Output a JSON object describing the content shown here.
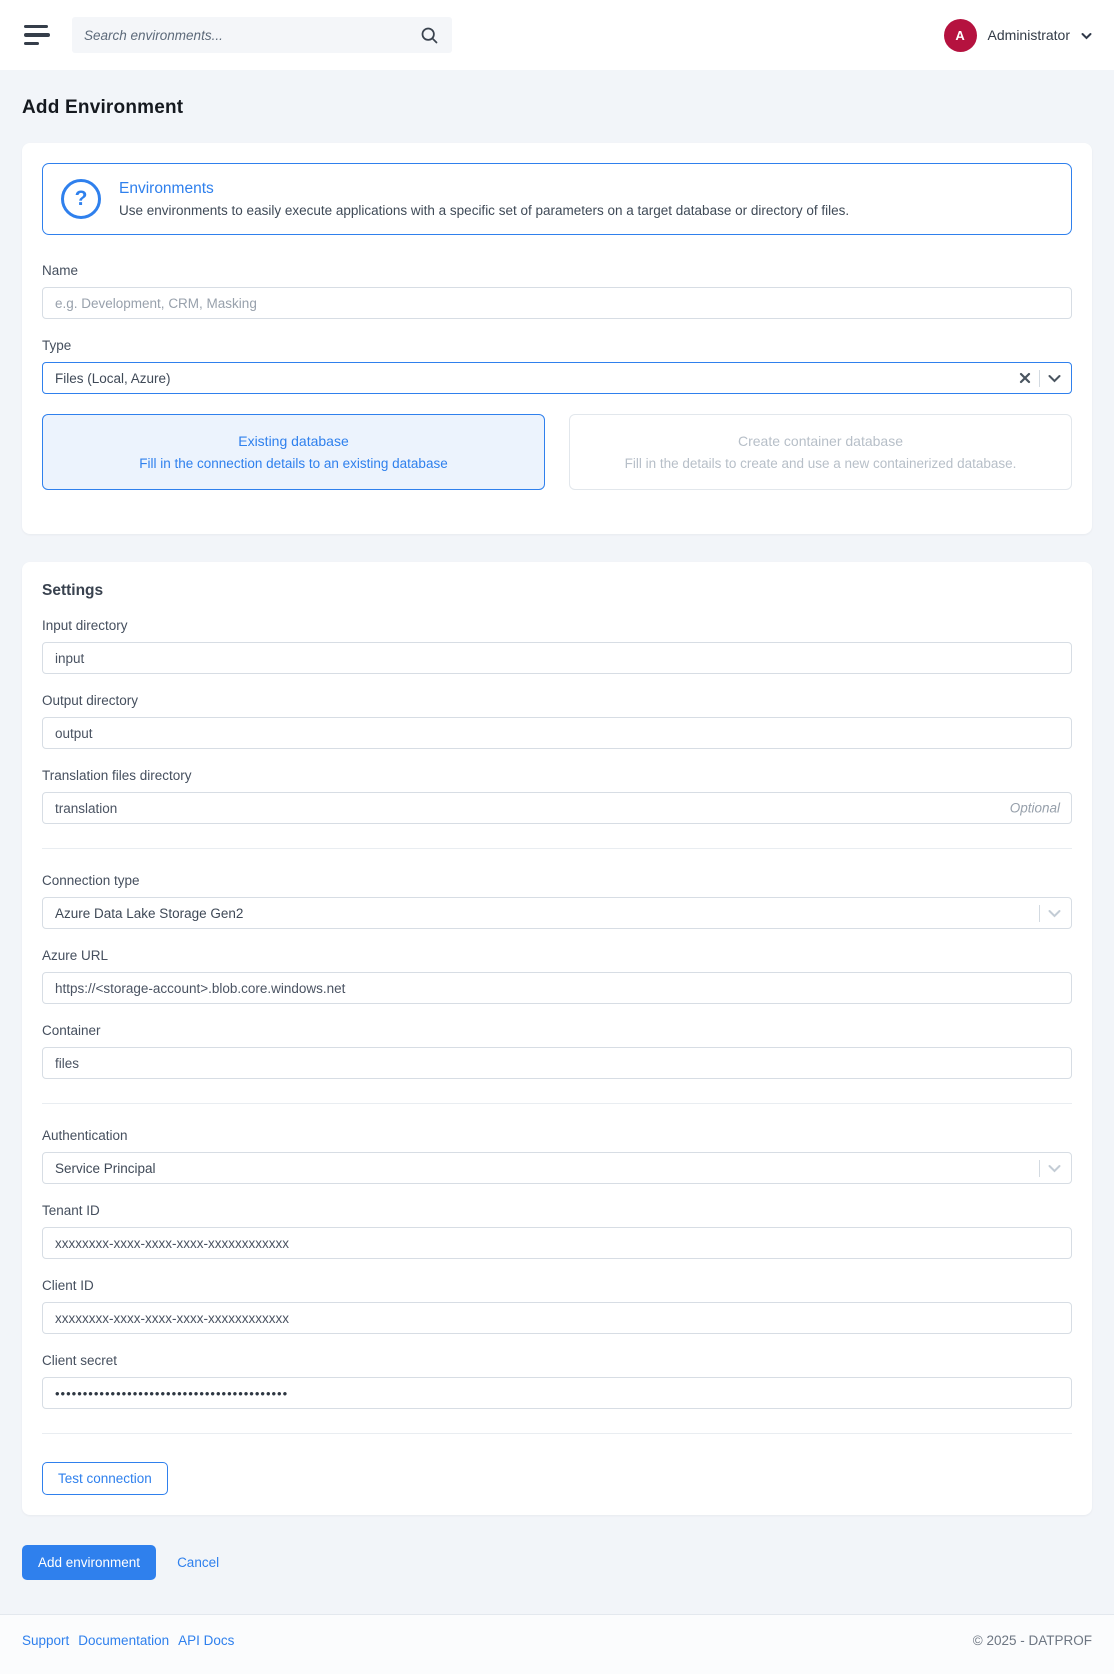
{
  "header": {
    "search_placeholder": "Search environments...",
    "user": {
      "initial": "A",
      "name": "Administrator"
    }
  },
  "page": {
    "title": "Add Environment"
  },
  "info_card": {
    "title": "Environments",
    "description": "Use environments to easily execute applications with a specific set of parameters on a target database or directory of files."
  },
  "form": {
    "name": {
      "label": "Name",
      "placeholder": "e.g. Development, CRM, Masking"
    },
    "type": {
      "label": "Type",
      "value": "Files (Local, Azure)"
    },
    "options": {
      "existing": {
        "title": "Existing database",
        "description": "Fill in the connection details to an existing database"
      },
      "container": {
        "title": "Create container database",
        "description": "Fill in the details to create and use a new containerized database."
      }
    }
  },
  "settings": {
    "heading": "Settings",
    "input_directory": {
      "label": "Input directory",
      "value": "input"
    },
    "output_directory": {
      "label": "Output directory",
      "value": "output"
    },
    "translation_directory": {
      "label": "Translation files directory",
      "value": "translation",
      "hint": "Optional"
    },
    "connection_type": {
      "label": "Connection type",
      "value": "Azure Data Lake Storage Gen2"
    },
    "azure_url": {
      "label": "Azure URL",
      "value": "https://<storage-account>.blob.core.windows.net"
    },
    "container": {
      "label": "Container",
      "value": "files"
    },
    "authentication": {
      "label": "Authentication",
      "value": "Service Principal"
    },
    "tenant_id": {
      "label": "Tenant ID",
      "value": "xxxxxxxx-xxxx-xxxx-xxxx-xxxxxxxxxxxx"
    },
    "client_id": {
      "label": "Client ID",
      "value": "xxxxxxxx-xxxx-xxxx-xxxx-xxxxxxxxxxxx"
    },
    "client_secret": {
      "label": "Client secret",
      "value": "••••••••••••••••••••••••••••••••••••••••••"
    },
    "test_button": "Test connection"
  },
  "actions": {
    "submit": "Add environment",
    "cancel": "Cancel"
  },
  "footer": {
    "links": [
      "Support",
      "Documentation",
      "API Docs"
    ],
    "copyright": "© 2025 - DATPROF"
  },
  "colors": {
    "primary": "#2f80ed",
    "avatar": "#b5123f",
    "page_background": "#f2f5f9"
  }
}
